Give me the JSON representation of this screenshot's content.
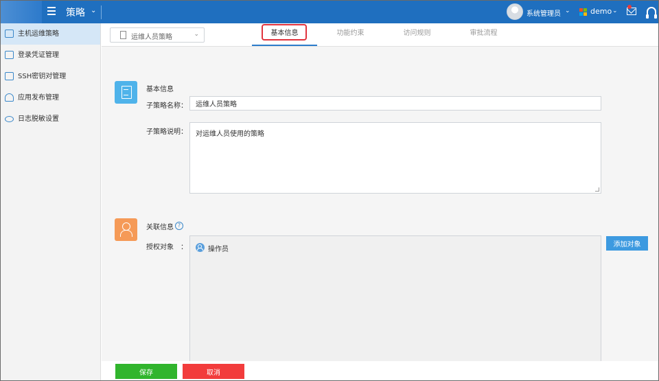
{
  "header": {
    "module_title": "策略",
    "user_name": "系统管理员",
    "tenant": "demo",
    "icons": [
      "menu-icon",
      "avatar",
      "ms-logo-icon",
      "mail-icon",
      "headset-icon"
    ]
  },
  "sidebar": {
    "items": [
      {
        "label": "主机运维策略",
        "icon": "monitor-icon",
        "active": true
      },
      {
        "label": "登录凭证管理",
        "icon": "credential-icon"
      },
      {
        "label": "SSH密钥对管理",
        "icon": "key-icon"
      },
      {
        "label": "应用发布管理",
        "icon": "cloud-icon"
      },
      {
        "label": "日志脱敏设置",
        "icon": "eye-icon"
      }
    ]
  },
  "toolbar": {
    "policy_select_value": "运维人员策略"
  },
  "tabs": [
    {
      "label": "基本信息",
      "active": true
    },
    {
      "label": "功能约束"
    },
    {
      "label": "访问规则"
    },
    {
      "label": "审批流程"
    }
  ],
  "basic_info": {
    "title": "基本信息",
    "name_label": "子策略名称：",
    "name_value": "运维人员策略",
    "desc_label": "子策略说明：",
    "desc_value": "对运维人员使用的策略"
  },
  "related_info": {
    "title": "关联信息",
    "help_glyph": "?",
    "auth_label": "授权对象",
    "auth_colon": "：",
    "auth_items": [
      "操作员"
    ],
    "add_button": "添加对象"
  },
  "footer": {
    "save": "保存",
    "cancel": "取消"
  },
  "colors": {
    "topbar": "#1f6fbf",
    "active_sidebar": "#d5e7f7",
    "save": "#31b52d",
    "cancel": "#f23c3c",
    "add_button": "#3d9ae0",
    "tab_highlight": "#e0323c"
  }
}
